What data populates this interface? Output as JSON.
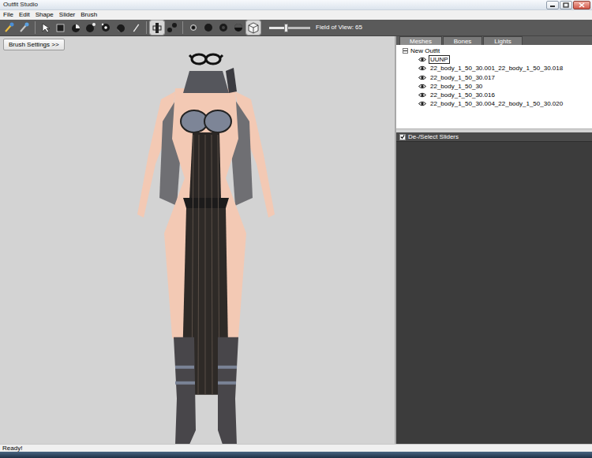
{
  "window": {
    "title": "Outfit Studio"
  },
  "menu": [
    "File",
    "Edit",
    "Shape",
    "Slider",
    "Brush"
  ],
  "toolbar": {
    "tools": [
      {
        "selected": false
      },
      {
        "selected": false
      },
      {
        "selected": false
      },
      {
        "selected": false
      },
      {
        "selected": false
      },
      {
        "selected": false
      },
      {
        "selected": false
      },
      {
        "selected": false
      },
      {
        "selected": false
      },
      {
        "selected": true
      },
      {
        "selected": false
      },
      {
        "selected": false
      },
      {
        "selected": false
      },
      {
        "selected": false
      },
      {
        "selected": false
      },
      {
        "selected": true
      }
    ],
    "fov": {
      "label": "Field of View: 65",
      "level": 0.4
    }
  },
  "viewport": {
    "brush_settings": "Brush Settings >>"
  },
  "panel_tabs": [
    {
      "label": "Meshes",
      "selected": true
    },
    {
      "label": "Bones",
      "selected": false
    },
    {
      "label": "Lights",
      "selected": false
    }
  ],
  "tree": {
    "root": {
      "label": "New Outfit",
      "expanded": true
    },
    "items": [
      {
        "label": "UUNP",
        "selected": true,
        "visible": true
      },
      {
        "label": "22_body_1_50_30.001_22_body_1_50_30.018",
        "selected": false,
        "visible": true
      },
      {
        "label": "22_body_1_50_30.017",
        "selected": false,
        "visible": true
      },
      {
        "label": "22_body_1_50_30",
        "selected": false,
        "visible": true
      },
      {
        "label": "22_body_1_50_30.016",
        "selected": false,
        "visible": true
      },
      {
        "label": "22_body_1_50_30.004_22_body_1_50_30.020",
        "selected": false,
        "visible": true
      }
    ]
  },
  "sliders": {
    "label": "De-/Select Sliders",
    "checked": true
  },
  "status_bar": "Ready!"
}
